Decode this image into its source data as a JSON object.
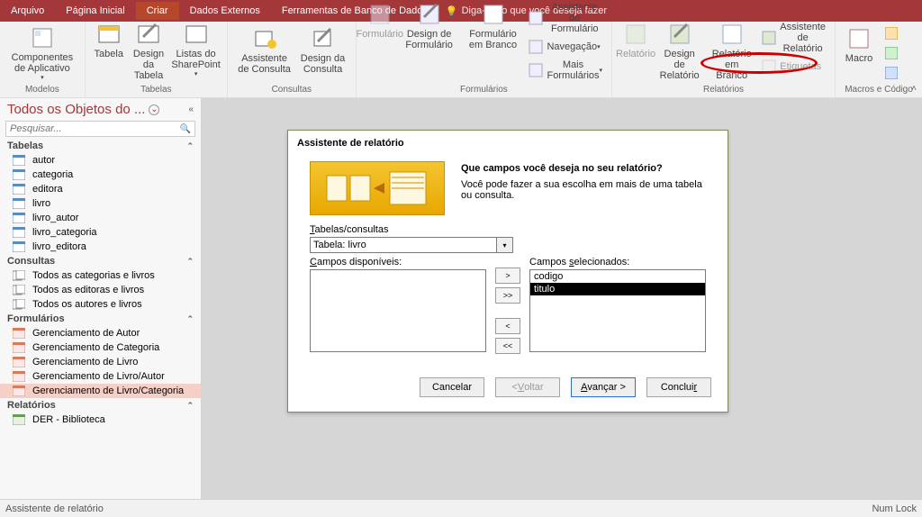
{
  "tabs": {
    "file": "Arquivo",
    "home": "Página Inicial",
    "create": "Criar",
    "external": "Dados Externos",
    "dbtools": "Ferramentas de Banco de Dados",
    "tell_me": "Diga-me o que você deseja fazer"
  },
  "ribbon": {
    "templates": {
      "label": "Modelos",
      "appparts": "Componentes de Aplicativo"
    },
    "tables": {
      "label": "Tabelas",
      "table": "Tabela",
      "tabledesign": "Design da Tabela",
      "splists": "Listas do SharePoint"
    },
    "queries": {
      "label": "Consultas",
      "qwizard": "Assistente de Consulta",
      "qdesign": "Design da Consulta"
    },
    "forms": {
      "label": "Formulários",
      "form": "Formulário",
      "formdesign": "Design de Formulário",
      "blankform": "Formulário em Branco",
      "formwizard": "Assistente de Formulário",
      "nav": "Navegação",
      "moreforms": "Mais Formulários"
    },
    "reports": {
      "label": "Relatórios",
      "report": "Relatório",
      "reportdesign": "Design de Relatório",
      "blankreport": "Relatório em Branco",
      "reportwizard": "Assistente de Relatório",
      "labels": "Etiquetas"
    },
    "macros": {
      "label": "Macros e Código",
      "macro": "Macro"
    }
  },
  "nav": {
    "title": "Todos os Objetos do ...",
    "search_placeholder": "Pesquisar...",
    "sections": {
      "tables": "Tabelas",
      "queries": "Consultas",
      "forms": "Formulários",
      "reports": "Relatórios"
    },
    "tables": [
      "autor",
      "categoria",
      "editora",
      "livro",
      "livro_autor",
      "livro_categoria",
      "livro_editora"
    ],
    "queries": [
      "Todos as categorias e livros",
      "Todos as editoras e livros",
      "Todos os autores e livros"
    ],
    "forms": [
      "Gerenciamento de Autor",
      "Gerenciamento de Categoria",
      "Gerenciamento de Livro",
      "Gerenciamento de Livro/Autor",
      "Gerenciamento de Livro/Categoria"
    ],
    "reports": [
      "DER - Biblioteca"
    ]
  },
  "wizard": {
    "title": "Assistente de relatório",
    "question": "Que campos você deseja no seu relatório?",
    "hint": "Você pode fazer a sua escolha em mais de uma tabela ou consulta.",
    "tc_label": "Tabelas/consultas",
    "tc_value": "Tabela: livro",
    "avail_label": "Campos disponíveis:",
    "sel_label": "Campos selecionados:",
    "selected": [
      "codigo",
      "titulo"
    ],
    "btn_cancel": "Cancelar",
    "btn_back": "< Voltar",
    "btn_next": "Avançar >",
    "btn_finish": "Concluir",
    "move_add": ">",
    "move_addall": ">>",
    "move_rem": "<",
    "move_remall": "<<"
  },
  "status": {
    "left": "Assistente de relatório",
    "right": "Num Lock"
  }
}
